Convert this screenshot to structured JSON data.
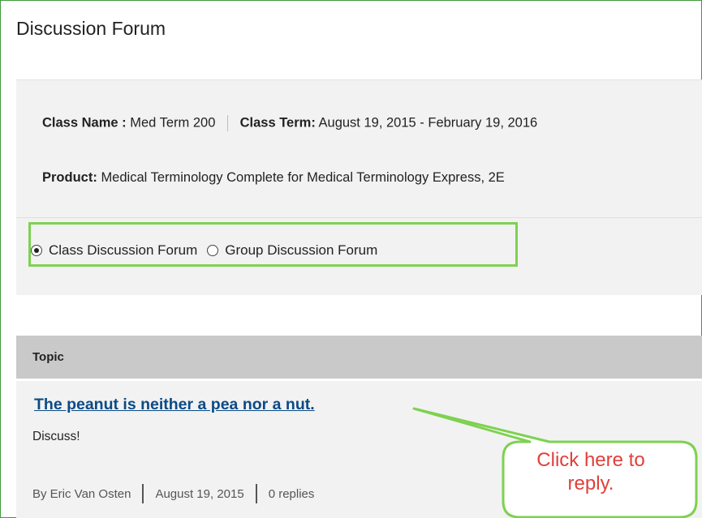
{
  "page": {
    "title": "Discussion Forum"
  },
  "class_info": {
    "class_name_label": "Class Name :",
    "class_name_value": "Med Term 200",
    "class_term_label": "Class Term:",
    "class_term_value": "August 19, 2015 - February 19, 2016",
    "product_label": "Product:",
    "product_value": "Medical Terminology Complete for Medical Terminology Express, 2E"
  },
  "forum_type": {
    "options": [
      {
        "label": "Class Discussion Forum",
        "checked": true
      },
      {
        "label": "Group Discussion Forum",
        "checked": false
      }
    ]
  },
  "topics": {
    "header": "Topic",
    "items": [
      {
        "title": "The peanut is neither a pea nor a nut.",
        "description": "Discuss!",
        "author": "By Eric Van Osten",
        "date": "August 19, 2015",
        "replies": "0 replies"
      }
    ]
  },
  "callout": {
    "line1": "Click here to",
    "line2": "reply.",
    "border_color": "#7ed151",
    "text_color": "#e0403a"
  }
}
